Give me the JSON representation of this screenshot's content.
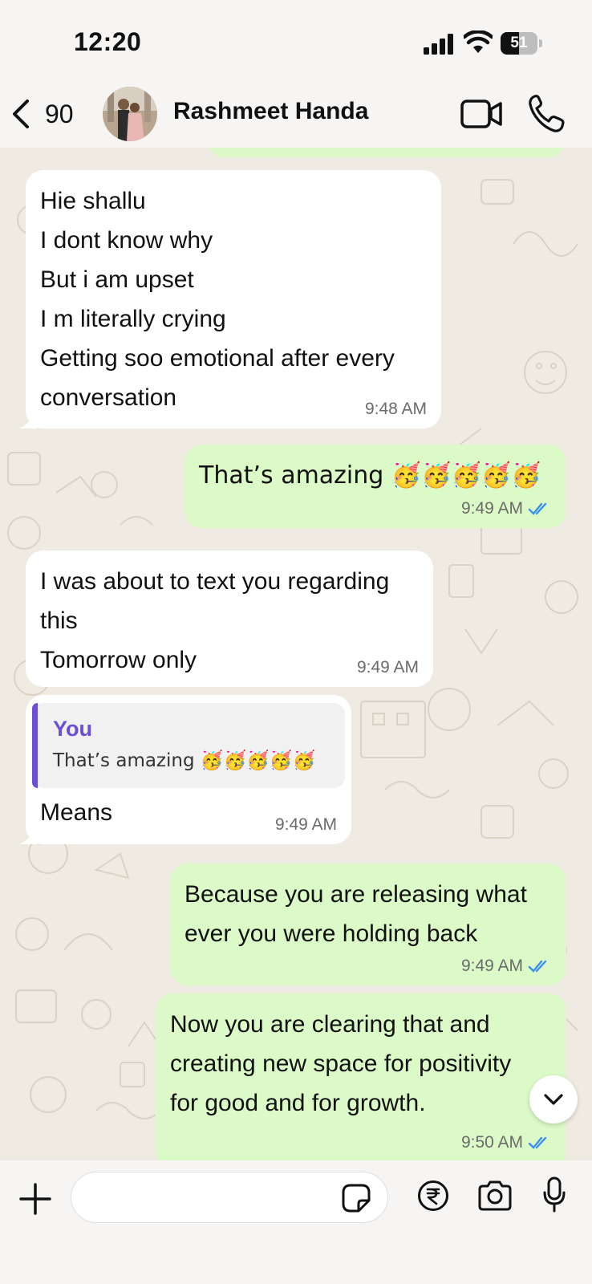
{
  "status_bar": {
    "time": "12:20",
    "battery_level": "51",
    "battery_fraction": 0.51
  },
  "header": {
    "back_count": "90",
    "contact_name": "Rashmeet Handa",
    "icons": [
      "chevron-left-icon",
      "video-call-icon",
      "phone-icon"
    ]
  },
  "messages": [
    {
      "direction": "incoming",
      "text": "Hie shallu\nI dont know why\nBut i am upset\nI m literally crying\nGetting soo emotional after every\nconversation",
      "time": "9:48 AM"
    },
    {
      "direction": "outgoing",
      "text": "That’s amazing 🥳🥳🥳🥳🥳",
      "time": "9:49 AM",
      "status": "read"
    },
    {
      "direction": "incoming",
      "text": "I was about to text you regarding\nthis\nTomorrow only",
      "time": "9:49 AM"
    },
    {
      "direction": "incoming",
      "quote": {
        "author": "You",
        "text": "That’s amazing 🥳🥳🥳🥳🥳"
      },
      "text": "Means",
      "time": "9:49 AM"
    },
    {
      "direction": "outgoing",
      "text": "Because you are releasing what\never you were holding back",
      "time": "9:49 AM",
      "status": "read"
    },
    {
      "direction": "outgoing",
      "text": "Now you are clearing that and\ncreating new space for positivity\nfor good and for growth.",
      "time": "9:50 AM",
      "status": "read"
    }
  ],
  "composer": {
    "input_value": "",
    "icons": [
      "plus-icon",
      "sticker-icon",
      "rupee-icon",
      "camera-icon",
      "microphone-icon"
    ]
  },
  "colors": {
    "incoming_bubble": "#ffffff",
    "outgoing_bubble": "#dcfac8",
    "read_ticks": "#3b8ef0",
    "quote_accent": "#6a4fd6",
    "chat_background": "#efeae2"
  }
}
